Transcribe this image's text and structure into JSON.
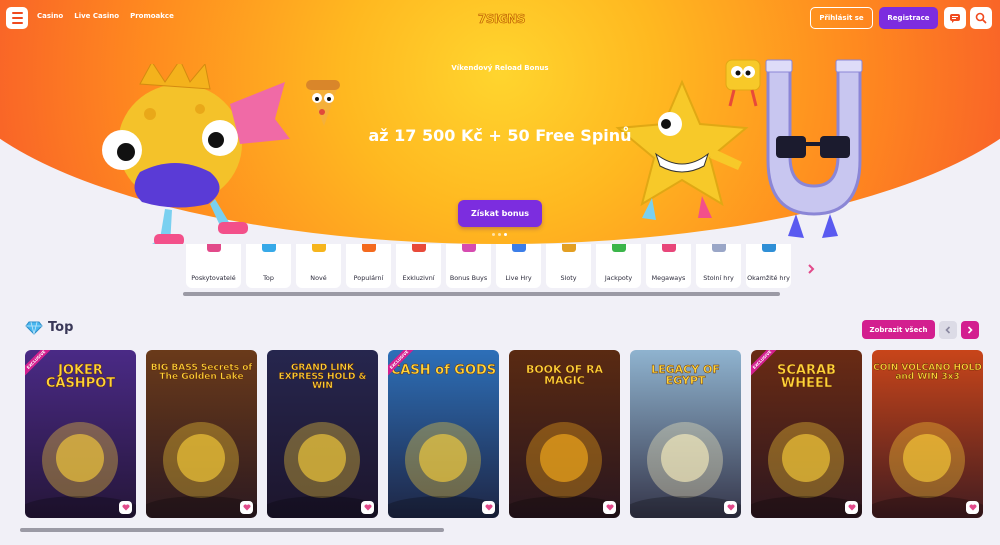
{
  "header": {
    "nav": [
      "Casino",
      "Live Casino",
      "Promoakce"
    ],
    "logo_text": "7SIGNS",
    "login_label": "Přihlásit se",
    "register_label": "Registrace",
    "chat_icon": "chat-icon",
    "search_icon": "search-icon"
  },
  "hero": {
    "subtitle": "Víkendový Reload Bonus",
    "title": "až 17 500 Kč + 50 Free Spinů",
    "cta": "Získat bonus",
    "slides": 3,
    "active_slide": 2
  },
  "categories": [
    {
      "label": "Poskytovatelé",
      "icon": "providers-icon",
      "color": "#e24a8a"
    },
    {
      "label": "Top",
      "icon": "diamond-icon",
      "color": "#37a9e8"
    },
    {
      "label": "Nové",
      "icon": "new-icon",
      "color": "#f6b51d"
    },
    {
      "label": "Populární",
      "icon": "fire-icon",
      "color": "#f46a1e"
    },
    {
      "label": "Exkluzivní",
      "icon": "gift-icon",
      "color": "#e84a3a"
    },
    {
      "label": "Bonus Buys",
      "icon": "bonus-gift-icon",
      "color": "#d64bb0"
    },
    {
      "label": "Live Hry",
      "icon": "live-icon",
      "color": "#3c7ee8"
    },
    {
      "label": "Sloty",
      "icon": "slots-icon",
      "color": "#e39f22"
    },
    {
      "label": "Jackpoty",
      "icon": "clover-icon",
      "color": "#3bb54a"
    },
    {
      "label": "Megaways",
      "icon": "megaways-icon",
      "color": "#e8467a"
    },
    {
      "label": "Stolní hry",
      "icon": "cards-icon",
      "color": "#9aa6c7"
    },
    {
      "label": "Okamžité hry",
      "icon": "instant-icon",
      "color": "#2f8fd6"
    }
  ],
  "top_section": {
    "title": "Top",
    "view_all": "Zobrazit všech",
    "games": [
      {
        "name": "JOKER CASHPOT",
        "exclusive": true,
        "exclusive_label": "EXCLUSIVE",
        "bg": "#4a2a86",
        "accent": "#ffd43a"
      },
      {
        "name": "BIG BASS Secrets of The Golden Lake",
        "exclusive": false,
        "bg": "#6a3a1a",
        "accent": "#ffd43a"
      },
      {
        "name": "GRAND LINK EXPRESS HOLD & WIN",
        "exclusive": false,
        "bg": "#26264e",
        "accent": "#ffd43a"
      },
      {
        "name": "CASH of GODS",
        "exclusive": true,
        "exclusive_label": "EXCLUSIVE",
        "bg": "#2d6fb8",
        "accent": "#ffd43a"
      },
      {
        "name": "BOOK OF RA MAGIC",
        "exclusive": false,
        "bg": "#5a2a12",
        "accent": "#ffb31a"
      },
      {
        "name": "LEGACY OF EGYPT",
        "exclusive": false,
        "bg": "#8fb3cf",
        "accent": "#fff3c0"
      },
      {
        "name": "SCARAB WHEEL",
        "exclusive": true,
        "exclusive_label": "EXCLUSIVE",
        "bg": "#6a2b14",
        "accent": "#ffd43a"
      },
      {
        "name": "COIN VOLCANO HOLD and WIN 3x3",
        "exclusive": false,
        "bg": "#c8451a",
        "accent": "#ffd43a"
      }
    ]
  }
}
